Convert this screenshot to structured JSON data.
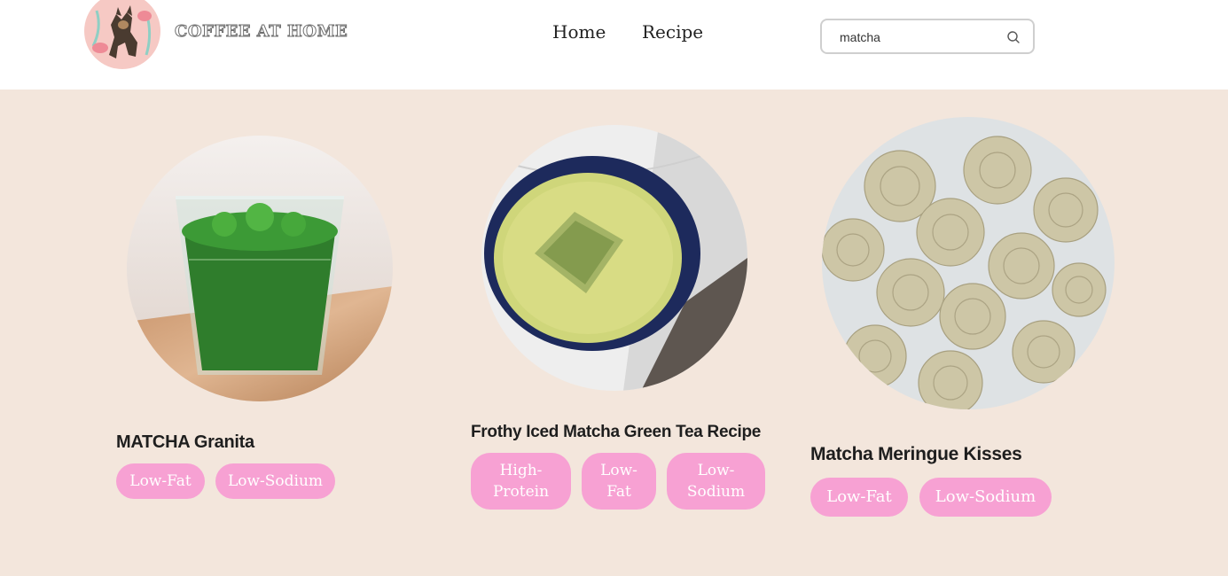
{
  "header": {
    "brand": "COFFEE AT HOME",
    "logo_icon": "dog-flamingo-logo-icon",
    "nav": [
      {
        "label": "Home"
      },
      {
        "label": "Recipe"
      }
    ],
    "search": {
      "value": "matcha",
      "icon": "search-icon"
    }
  },
  "colors": {
    "page_bg": "#f3e6dc",
    "header_bg": "#ffffff",
    "tag_bg": "#f7a1d3",
    "tag_text": "#ffffff"
  },
  "recipes": [
    {
      "title": "MATCHA Granita",
      "tags": [
        "Low-Fat",
        "Low-Sodium"
      ]
    },
    {
      "title": "Frothy Iced Matcha Green Tea Recipe",
      "tags": [
        "High-Protein",
        "Low-Fat",
        "Low-Sodium"
      ]
    },
    {
      "title": "Matcha Meringue Kisses",
      "tags": [
        "Low-Fat",
        "Low-Sodium"
      ]
    }
  ]
}
